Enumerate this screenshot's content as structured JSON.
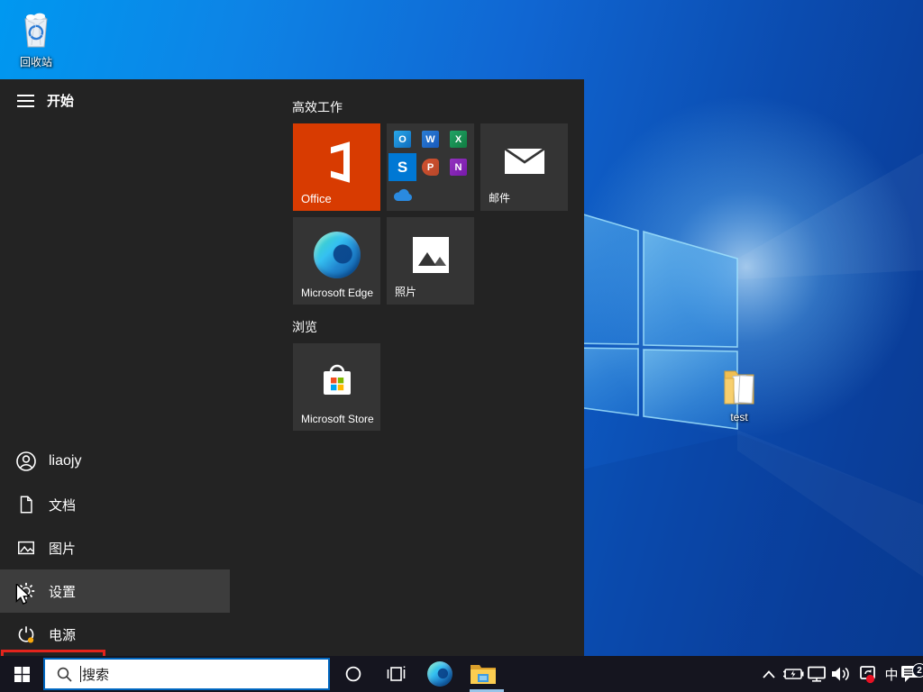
{
  "desktop": {
    "recycle_bin_label": "回收站",
    "test_folder_label": "test"
  },
  "start_menu": {
    "title": "开始",
    "groups": [
      {
        "title": "高效工作"
      },
      {
        "title": "浏览"
      }
    ],
    "tiles": [
      {
        "id": "office",
        "label": "Office"
      },
      {
        "id": "office-suite",
        "label": ""
      },
      {
        "id": "mail",
        "label": "邮件"
      },
      {
        "id": "edge",
        "label": "Microsoft Edge"
      },
      {
        "id": "photos",
        "label": "照片"
      },
      {
        "id": "store",
        "label": "Microsoft Store"
      }
    ],
    "office_apps": [
      {
        "name": "Outlook",
        "letter": "O"
      },
      {
        "name": "Word",
        "letter": "W"
      },
      {
        "name": "Excel",
        "letter": "X"
      },
      {
        "name": "Skype",
        "letter": "S"
      },
      {
        "name": "PowerPoint",
        "letter": "P"
      },
      {
        "name": "OneNote",
        "letter": "N"
      },
      {
        "name": "OneDrive",
        "letter": ""
      }
    ],
    "rail": [
      {
        "id": "user",
        "label": "liaojy"
      },
      {
        "id": "documents",
        "label": "文档"
      },
      {
        "id": "pictures",
        "label": "图片"
      },
      {
        "id": "settings",
        "label": "设置",
        "highlighted": true
      },
      {
        "id": "power",
        "label": "电源"
      }
    ]
  },
  "taskbar": {
    "search_placeholder": "搜索",
    "ime_indicator": "中",
    "notification_badge": "2"
  },
  "colors": {
    "accent": "#0078d7",
    "annotation_red": "#e3241d",
    "office_orange": "#d83b01",
    "menu_bg": "#232323",
    "tile_bg": "#343434",
    "taskbar_bg": "#15151f"
  }
}
